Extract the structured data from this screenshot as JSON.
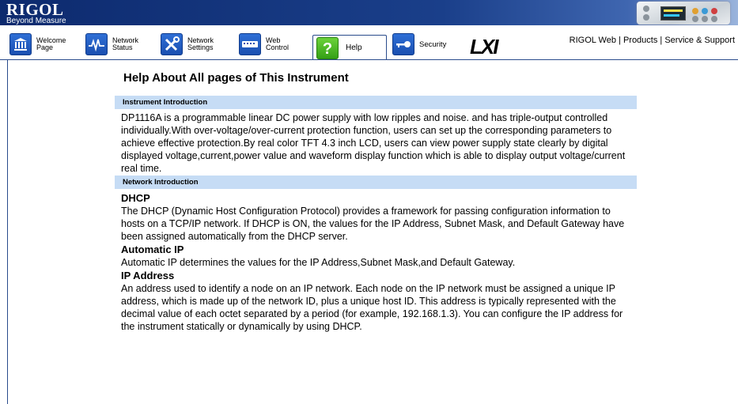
{
  "banner": {
    "brand": "RIGOL",
    "tagline": "Beyond Measure"
  },
  "nav": {
    "tabs": [
      {
        "label_1": "Welcome",
        "label_2": "Page",
        "icon": "building-icon"
      },
      {
        "label_1": "Network",
        "label_2": "Status",
        "icon": "network-status-icon"
      },
      {
        "label_1": "Network",
        "label_2": "Settings",
        "icon": "tools-icon"
      },
      {
        "label_1": "Web",
        "label_2": "Control",
        "icon": "keyboard-icon"
      },
      {
        "label_1": "Help",
        "label_2": "",
        "icon": "question-icon"
      },
      {
        "label_1": "Security",
        "label_2": "",
        "icon": "key-icon"
      }
    ],
    "lxi": "LXI",
    "links": [
      "RIGOL Web",
      "Products",
      "Service & Support"
    ],
    "separator": "|"
  },
  "page": {
    "title": "Help About All pages of This Instrument",
    "sections": [
      {
        "header": "Instrument  Introduction",
        "text": "DP1116A is a programmable linear DC power supply with low ripples and noise. and has triple-output controlled individually.With over-voltage/over-current protection function, users can set up the corresponding parameters to achieve effective protection.By real color TFT 4.3 inch LCD, users can view power supply state clearly by digital displayed voltage,current,power value and waveform display function which is able to display output voltage/current real time."
      },
      {
        "header": "Network  Introduction",
        "items": [
          {
            "title": "DHCP",
            "text": "The DHCP (Dynamic Host Configuration Protocol) provides a framework for passing configuration information to hosts on a TCP/IP network. If DHCP is ON, the values for the IP Address, Subnet Mask, and Default Gateway have been assigned automatically from the DHCP server."
          },
          {
            "title": "Automatic IP",
            "text": "Automatic IP determines the values for the IP Address,Subnet Mask,and Default Gateway."
          },
          {
            "title": "IP Address",
            "text": "An address used to identify a node on an IP network. Each node on the IP network must be assigned a unique IP address, which is made up of the network ID, plus a unique host ID. This address is typically represented with the decimal value of each octet separated by a period (for example, 192.168.1.3). You can configure the IP address for the instrument statically or dynamically by using DHCP."
          }
        ]
      }
    ]
  },
  "colors": {
    "banner": "#1a3f8a",
    "section_header": "#c6dcf5",
    "active_icon": "#34a015",
    "tab_icon": "#1a4fb0"
  }
}
